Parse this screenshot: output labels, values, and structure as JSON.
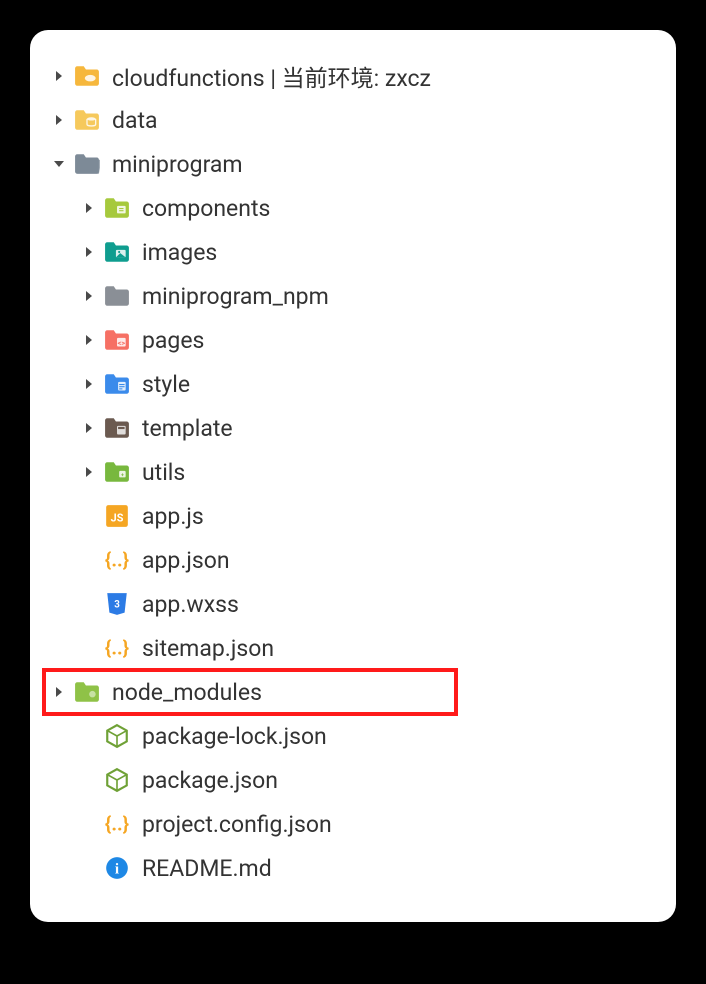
{
  "tree": [
    {
      "id": "cloudfunctions",
      "label": "cloudfunctions | 当前环境: zxcz",
      "depth": 0,
      "arrow": "right",
      "icon": "folder-cloud",
      "iconColor": "#f6b73c"
    },
    {
      "id": "data",
      "label": "data",
      "depth": 0,
      "arrow": "right",
      "icon": "folder-db",
      "iconColor": "#f6c95c"
    },
    {
      "id": "miniprogram",
      "label": "miniprogram",
      "depth": 0,
      "arrow": "down",
      "icon": "folder-open",
      "iconColor": "#7d8a97"
    },
    {
      "id": "components",
      "label": "components",
      "depth": 1,
      "arrow": "right",
      "icon": "folder-comp",
      "iconColor": "#a6c93d"
    },
    {
      "id": "images",
      "label": "images",
      "depth": 1,
      "arrow": "right",
      "icon": "folder-img",
      "iconColor": "#0f9d8f"
    },
    {
      "id": "miniprogram_npm",
      "label": "miniprogram_npm",
      "depth": 1,
      "arrow": "right",
      "icon": "folder",
      "iconColor": "#8a8f96"
    },
    {
      "id": "pages",
      "label": "pages",
      "depth": 1,
      "arrow": "right",
      "icon": "folder-pages",
      "iconColor": "#f67064"
    },
    {
      "id": "style",
      "label": "style",
      "depth": 1,
      "arrow": "right",
      "icon": "folder-style",
      "iconColor": "#3b8beb"
    },
    {
      "id": "template",
      "label": "template",
      "depth": 1,
      "arrow": "right",
      "icon": "folder-tpl",
      "iconColor": "#6b5a50"
    },
    {
      "id": "utils",
      "label": "utils",
      "depth": 1,
      "arrow": "right",
      "icon": "folder-utils",
      "iconColor": "#78b83e"
    },
    {
      "id": "app_js",
      "label": "app.js",
      "depth": 1,
      "arrow": "none",
      "icon": "file-js",
      "iconColor": "#f5a623"
    },
    {
      "id": "app_json",
      "label": "app.json",
      "depth": 1,
      "arrow": "none",
      "icon": "file-json",
      "iconColor": "#f5a623"
    },
    {
      "id": "app_wxss",
      "label": "app.wxss",
      "depth": 1,
      "arrow": "none",
      "icon": "file-css",
      "iconColor": "#2c7be5"
    },
    {
      "id": "sitemap_json",
      "label": "sitemap.json",
      "depth": 1,
      "arrow": "none",
      "icon": "file-json",
      "iconColor": "#f5a623"
    },
    {
      "id": "node_modules",
      "label": "node_modules",
      "depth": 0,
      "arrow": "right",
      "icon": "folder-node",
      "iconColor": "#8fc247",
      "highlight": true
    },
    {
      "id": "package_lock",
      "label": "package-lock.json",
      "depth": 1,
      "arrow": "none",
      "icon": "file-node",
      "iconColor": "#6fa136"
    },
    {
      "id": "package_json",
      "label": "package.json",
      "depth": 1,
      "arrow": "none",
      "icon": "file-node",
      "iconColor": "#6fa136"
    },
    {
      "id": "project_config",
      "label": "project.config.json",
      "depth": 1,
      "arrow": "none",
      "icon": "file-json",
      "iconColor": "#f5a623"
    },
    {
      "id": "readme",
      "label": "README.md",
      "depth": 1,
      "arrow": "none",
      "icon": "file-info",
      "iconColor": "#1e88e5"
    }
  ]
}
